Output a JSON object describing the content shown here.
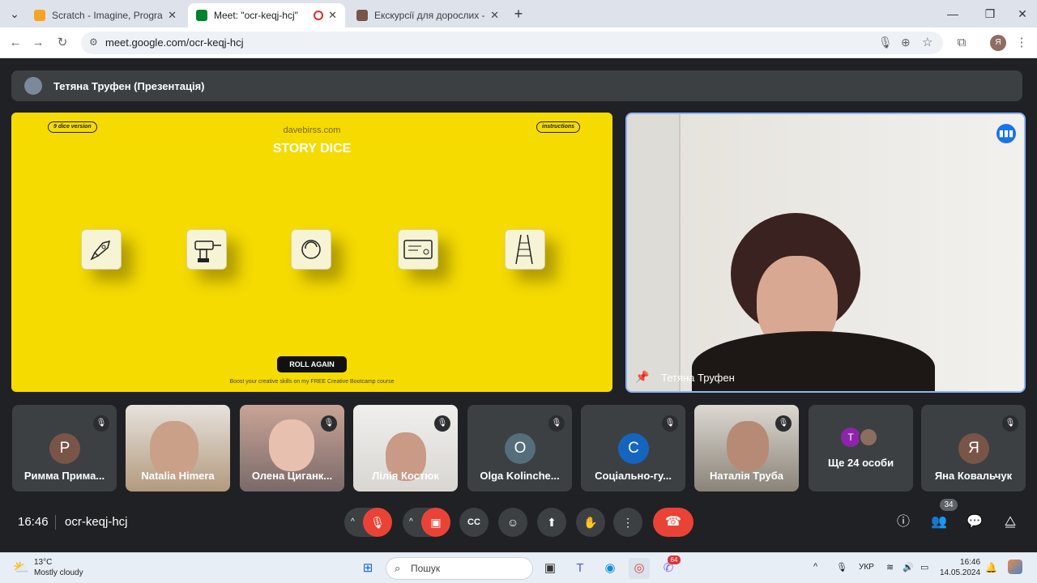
{
  "browser": {
    "tabs": [
      {
        "title": "Scratch - Imagine, Program, Sh",
        "active": false,
        "favicon_color": "#f7a325"
      },
      {
        "title": "Meet: \"ocr-keqj-hcj\"",
        "active": true,
        "favicon_color": "#00832d"
      },
      {
        "title": "Екскурсії для дорослих - ЗАМ",
        "active": false,
        "favicon_color": "#795548"
      }
    ],
    "url": "meet.google.com/ocr-keqj-hcj",
    "profile_initial": "Я"
  },
  "meet": {
    "presenter_bar": "Тетяна Труфен (Презентація)",
    "slide": {
      "pill_left": "9 dice version",
      "pill_right": "instructions",
      "site": "davebirss.com",
      "title": "STORY DICE",
      "dice_icons": [
        "rocket-icon",
        "drill-icon",
        "circle-icon",
        "card-icon",
        "ladder-icon"
      ],
      "button": "ROLL AGAIN",
      "footer": "Boost your creative skills on my FREE Creative Bootcamp course"
    },
    "speaker": {
      "name": "Тетяна Труфен"
    },
    "participants": [
      {
        "name": "Римма Прима...",
        "initial": "Р",
        "avatar_color": "#795548",
        "video": false
      },
      {
        "name": "Natalia Himera",
        "video": true,
        "bg": "#b39a7e"
      },
      {
        "name": "Олена Циганк...",
        "video": true,
        "bg": "#c9a496"
      },
      {
        "name": "Лілія Костюк",
        "video": true,
        "bg": "#d9d6d2"
      },
      {
        "name": "Olga Kolinche...",
        "initial": "O",
        "avatar_color": "#546e7a",
        "video": false
      },
      {
        "name": "Соціально-гу...",
        "initial": "С",
        "avatar_color": "#1565c0",
        "video": false
      },
      {
        "name": "Наталія Труба",
        "video": true,
        "bg": "#b7b0a6"
      },
      {
        "name": "Ще 24 особи",
        "initial": "Т",
        "avatar_color": "#8e24aa",
        "video": false
      },
      {
        "name": "Яна Ковальчук",
        "initial": "Я",
        "avatar_color": "#795548",
        "video": false
      }
    ],
    "time": "16:46",
    "meeting_code": "ocr-keqj-hcj",
    "participant_count": "34"
  },
  "taskbar": {
    "temperature": "13°C",
    "weather": "Mostly cloudy",
    "search_placeholder": "Пошук",
    "language": "УКР",
    "time": "16:46",
    "date": "14.05.2024",
    "notification_count": "64"
  }
}
